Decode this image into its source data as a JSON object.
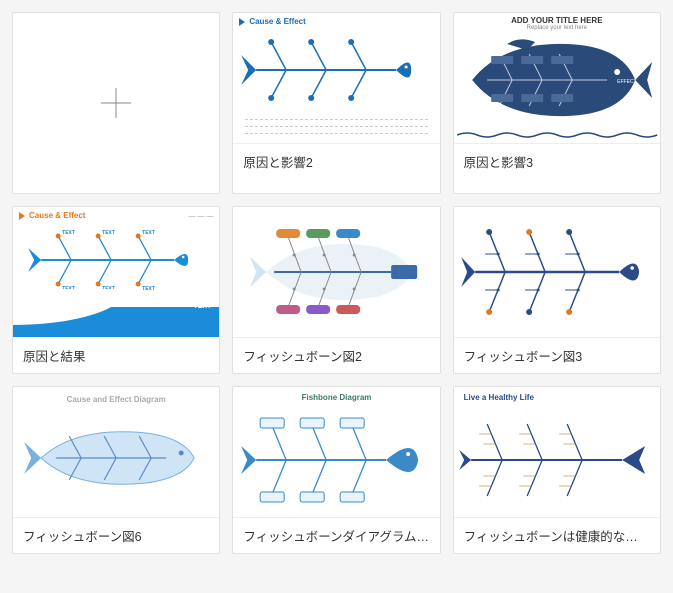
{
  "cards": [
    {
      "id": "blank",
      "label": "",
      "thumb": "blank"
    },
    {
      "id": "ce2",
      "label": "原因と影響2",
      "thumb": "ce2",
      "header": "Cause & Effect"
    },
    {
      "id": "ce3",
      "label": "原因と影響3",
      "thumb": "ce3",
      "header": "ADD YOUR TITLE HERE",
      "sub": "Replace your text here",
      "effect": "EFFECT"
    },
    {
      "id": "cr",
      "label": "原因と結果",
      "thumb": "cr",
      "header": "Cause & Effect",
      "sidetext": "TEXT"
    },
    {
      "id": "fb2",
      "label": "フィッシュボーン図2",
      "thumb": "fb2"
    },
    {
      "id": "fb3",
      "label": "フィッシュボーン図3",
      "thumb": "fb3"
    },
    {
      "id": "fb6",
      "label": "フィッシュボーン図6",
      "thumb": "fb6",
      "header": "Cause and Effect Diagram"
    },
    {
      "id": "fbtpl",
      "label": "フィッシュボーンダイアグラムテンプレート",
      "thumb": "fbtpl",
      "header": "Fishbone Diagram"
    },
    {
      "id": "healthy",
      "label": "フィッシュボーンは健康的な生活を送る",
      "thumb": "healthy",
      "header": "Live a Healthy Life"
    }
  ]
}
